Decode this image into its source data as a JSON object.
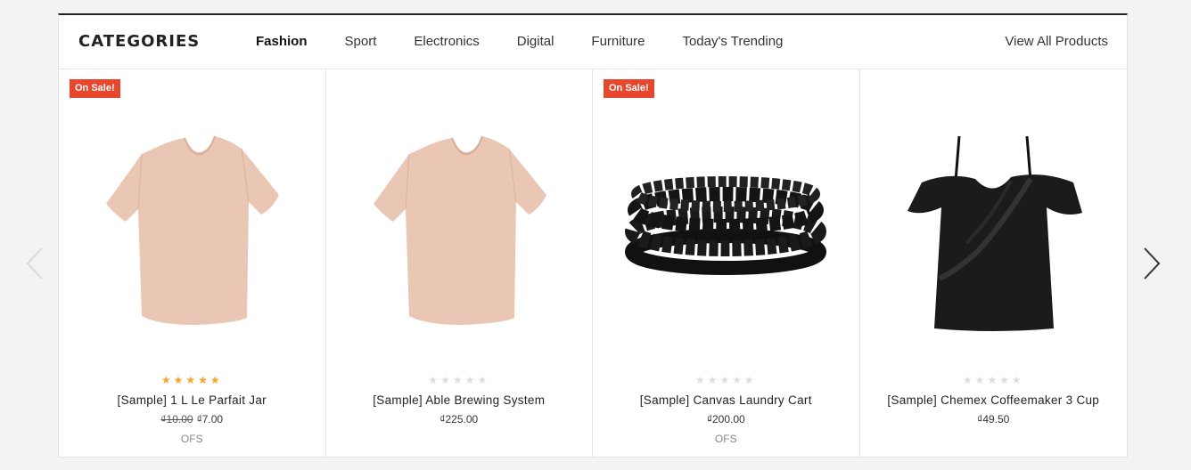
{
  "header": {
    "title": "CATEGORIES",
    "tabs": [
      {
        "label": "Fashion",
        "active": true
      },
      {
        "label": "Sport"
      },
      {
        "label": "Electronics"
      },
      {
        "label": "Digital"
      },
      {
        "label": "Furniture"
      },
      {
        "label": "Today's Trending"
      }
    ],
    "view_all": "View All Products"
  },
  "products": [
    {
      "badge": "On Sale!",
      "rating": 5,
      "name": "[Sample] 1 L Le Parfait Jar",
      "old_price": "₫10.00",
      "price": "₫7.00",
      "stock": "OFS",
      "image": "pink-tshirt"
    },
    {
      "badge": "",
      "rating": 0,
      "name": "[Sample] Able Brewing System",
      "old_price": "",
      "price": "₫225.00",
      "stock": "",
      "image": "pink-tshirt"
    },
    {
      "badge": "On Sale!",
      "rating": 0,
      "name": "[Sample] Canvas Laundry Cart",
      "old_price": "",
      "price": "₫200.00",
      "stock": "OFS",
      "image": "black-bead-bracelet"
    },
    {
      "badge": "",
      "rating": 0,
      "name": "[Sample] Chemex Coffeemaker 3 Cup",
      "old_price": "",
      "price": "₫49.50",
      "stock": "",
      "image": "black-ruffle-top"
    }
  ],
  "carousel": {
    "prev_icon": "chevron-left-icon",
    "next_icon": "chevron-right-icon"
  },
  "colors": {
    "accent": "#e6472d",
    "star": "#f5a623",
    "header_border": "#222222"
  }
}
